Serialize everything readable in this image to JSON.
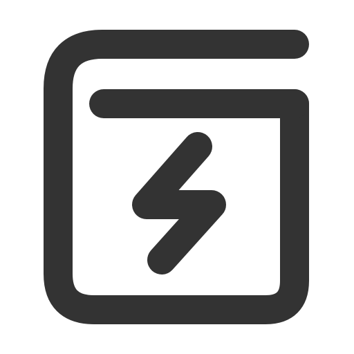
{
  "icon": {
    "name": "wallet-lightning-icon",
    "stroke_color": "#333333",
    "background_color": "#ffffff"
  }
}
